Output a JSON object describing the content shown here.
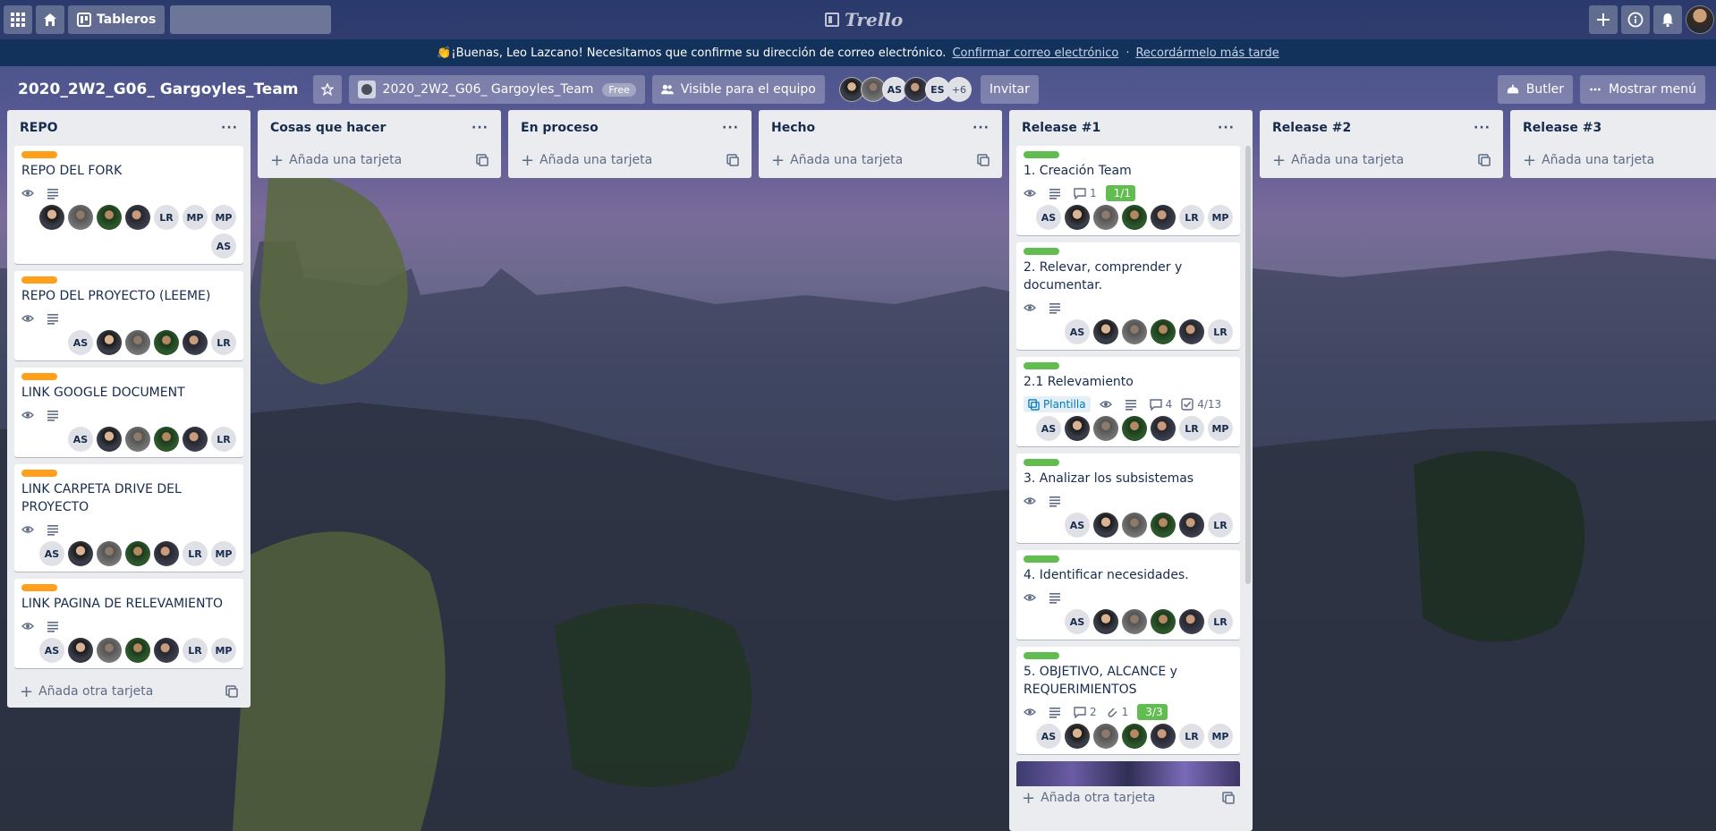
{
  "nav": {
    "boards_label": "Tableros",
    "search_placeholder": "",
    "logo_text": "Trello"
  },
  "banner": {
    "message": "👏¡Buenas, Leo Lazcano! Necesitamos que confirme su dirección de correo electrónico.",
    "confirm_link": "Confirmar correo electrónico",
    "separator": "·",
    "later_link": "Recordármelo más tarde"
  },
  "board": {
    "title": "2020_2W2_G06_ Gargoyles_Team",
    "team_name": "2020_2W2_G06_ Gargoyles_Team",
    "team_badge": "Free",
    "visibility": "Visible para el equipo",
    "members": [
      "",
      "",
      "AS",
      "",
      "ES"
    ],
    "more_members": "+6",
    "invite_label": "Invitar",
    "butler_label": "Butler",
    "menu_label": "Mostrar menú"
  },
  "lists": [
    {
      "name": "REPO",
      "add_label": "Añada otra tarjeta",
      "cards": [
        {
          "title": "REPO DEL FORK",
          "label_color": "orange",
          "members": [
            "p1",
            "p2",
            "p3",
            "p4",
            "LR",
            "MP",
            "MP",
            "AS"
          ]
        },
        {
          "title": "REPO DEL PROYECTO (LEEME)",
          "label_color": "orange",
          "members": [
            "AS",
            "p1",
            "p2",
            "p3",
            "p4",
            "LR"
          ]
        },
        {
          "title": "LINK GOOGLE DOCUMENT",
          "label_color": "orange",
          "members": [
            "AS",
            "p1",
            "p2",
            "p3",
            "p4",
            "LR"
          ]
        },
        {
          "title": "LINK CARPETA DRIVE DEL PROYECTO",
          "label_color": "orange",
          "members": [
            "AS",
            "p1",
            "p2",
            "p3",
            "p4",
            "LR",
            "MP"
          ]
        },
        {
          "title": "LINK PAGINA DE RELEVAMIENTO",
          "label_color": "orange",
          "members": [
            "AS",
            "p1",
            "p2",
            "p3",
            "p4",
            "LR",
            "MP"
          ]
        }
      ]
    },
    {
      "name": "Cosas que hacer",
      "add_label": "Añada una tarjeta",
      "cards": []
    },
    {
      "name": "En proceso",
      "add_label": "Añada una tarjeta",
      "cards": []
    },
    {
      "name": "Hecho",
      "add_label": "Añada una tarjeta",
      "cards": []
    },
    {
      "name": "Release #1",
      "add_label": "Añada otra tarjeta",
      "cards": [
        {
          "title": "1. Creación Team",
          "label_color": "green",
          "comments": "1",
          "checklist": "1/1",
          "members": [
            "AS",
            "p1",
            "p2",
            "p3",
            "p4",
            "LR",
            "MP"
          ]
        },
        {
          "title": "2. Relevar, comprender y documentar.",
          "label_color": "green",
          "members": [
            "AS",
            "p1",
            "p2",
            "p3",
            "p4",
            "LR"
          ]
        },
        {
          "title": "2.1 Relevamiento",
          "label_color": "green",
          "template": "Plantilla",
          "comments": "4",
          "checklist_plain": "4/13",
          "members": [
            "AS",
            "p1",
            "p2",
            "p3",
            "p4",
            "LR",
            "MP"
          ]
        },
        {
          "title": "3. Analizar los subsistemas",
          "label_color": "green",
          "members": [
            "AS",
            "p1",
            "p2",
            "p3",
            "p4",
            "LR"
          ]
        },
        {
          "title": "4. Identificar necesidades.",
          "label_color": "green",
          "members": [
            "AS",
            "p1",
            "p2",
            "p3",
            "p4",
            "LR"
          ]
        },
        {
          "title": "5. OBJETIVO, ALCANCE y REQUERIMIENTOS",
          "label_color": "green",
          "comments": "2",
          "attachments": "1",
          "checklist": "3/3",
          "members": [
            "AS",
            "p1",
            "p2",
            "p3",
            "p4",
            "LR",
            "MP"
          ]
        }
      ]
    },
    {
      "name": "Release #2",
      "add_label": "Añada una tarjeta",
      "cards": []
    },
    {
      "name": "Release #3",
      "add_label": "Añada una tarjeta",
      "cards": []
    }
  ],
  "colors": {
    "orange_label": "#ff9f1a",
    "green_label": "#61bd4f",
    "banner_bg": "#12325b",
    "list_bg": "#ebecf0"
  },
  "icons": [
    "apps-icon",
    "home-icon",
    "boards-icon",
    "search-icon",
    "plus-icon",
    "info-icon",
    "bell-icon",
    "star-icon",
    "visibility-icon",
    "butler-icon",
    "more-icon",
    "eye-icon",
    "description-icon",
    "comment-icon",
    "checklist-icon",
    "attachment-icon",
    "template-icon",
    "card-template-icon"
  ]
}
